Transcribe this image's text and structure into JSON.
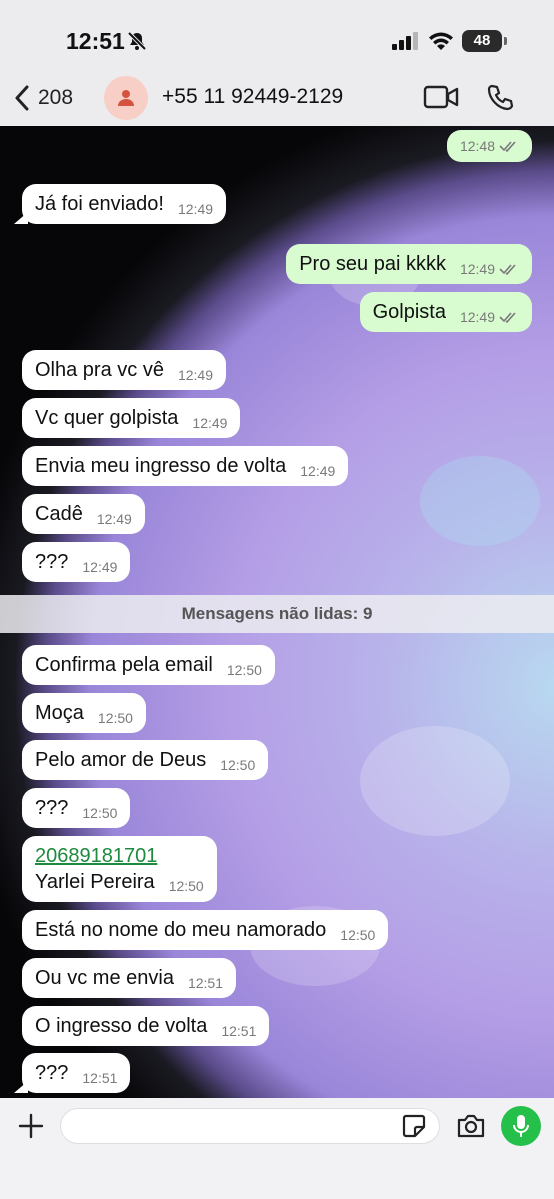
{
  "status": {
    "time": "12:51",
    "battery": "48"
  },
  "header": {
    "back_count": "208",
    "contact": "+55 11 92449-2129"
  },
  "messages_top": [
    {
      "text": "",
      "time": "12:48",
      "dir": "out"
    },
    {
      "text": "Já foi enviado!",
      "time": "12:49",
      "dir": "in"
    },
    {
      "text": "Pro seu pai kkkk",
      "time": "12:49",
      "dir": "out"
    },
    {
      "text": "Golpista",
      "time": "12:49",
      "dir": "out"
    },
    {
      "text": "Olha pra vc vê",
      "time": "12:49",
      "dir": "in"
    },
    {
      "text": "Vc quer golpista",
      "time": "12:49",
      "dir": "in"
    },
    {
      "text": "Envia meu ingresso de volta",
      "time": "12:49",
      "dir": "in"
    },
    {
      "text": "Cadê",
      "time": "12:49",
      "dir": "in"
    },
    {
      "text": "???",
      "time": "12:49",
      "dir": "in"
    }
  ],
  "unread_label": "Mensagens não lidas: 9",
  "messages_bottom": [
    {
      "text": "Confirma pela email",
      "time": "12:50"
    },
    {
      "text": "Moça",
      "time": "12:50"
    },
    {
      "text": "Pelo amor de Deus",
      "time": "12:50"
    },
    {
      "text": "???",
      "time": "12:50"
    },
    {
      "link": "20689181701",
      "text": "Yarlei Pereira",
      "time": "12:50"
    },
    {
      "text": "Está no nome do meu namorado",
      "time": "12:50"
    },
    {
      "text": "Ou vc me envia",
      "time": "12:51"
    },
    {
      "text": "O ingresso de volta",
      "time": "12:51"
    },
    {
      "text": "???",
      "time": "12:51"
    }
  ],
  "composer": {
    "placeholder": ""
  }
}
